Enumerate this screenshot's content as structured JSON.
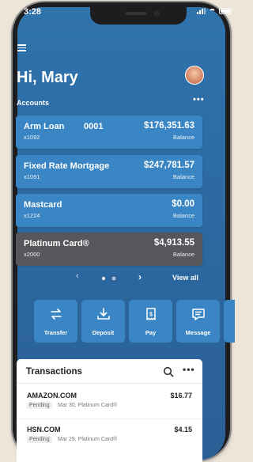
{
  "status_bar": {
    "time": "3:28"
  },
  "header": {
    "greeting": "Hi, Mary"
  },
  "accounts": {
    "label": "Accounts",
    "more": "•••",
    "items": [
      {
        "name": "Arm Loan",
        "code": "0001",
        "number": "x1092",
        "amount": "$176,351.63",
        "balance_label": "Balance"
      },
      {
        "name": "Fixed Rate Mortgage",
        "code": "",
        "number": "x1091",
        "amount": "$247,781.57",
        "balance_label": "Balance"
      },
      {
        "name": "Mastcard",
        "code": "",
        "number": "x1224",
        "amount": "$0.00",
        "balance_label": "Balance"
      },
      {
        "name": "Platinum Card®",
        "code": "",
        "number": "x2000",
        "amount": "$4,913.55",
        "balance_label": "Balance"
      }
    ],
    "pager": {
      "prev": "‹",
      "next": "›",
      "view_all": "View all"
    }
  },
  "actions": [
    {
      "label": "Transfer",
      "icon": "transfer-icon"
    },
    {
      "label": "Deposit",
      "icon": "deposit-icon"
    },
    {
      "label": "Pay",
      "icon": "pay-icon"
    },
    {
      "label": "Message",
      "icon": "message-icon"
    }
  ],
  "transactions": {
    "title": "Transactions",
    "more": "•••",
    "items": [
      {
        "merchant": "AMAZON.COM",
        "amount": "$16.77",
        "status": "Pending",
        "detail": "Mar 30, Platinum Card®"
      },
      {
        "merchant": "HSN.COM",
        "amount": "$4.15",
        "status": "Pending",
        "detail": "Mar 29, Platinum Card®"
      }
    ]
  },
  "colors": {
    "background": "#2d6aa3",
    "card": "#3a86c4",
    "card_dark": "#55575b"
  }
}
